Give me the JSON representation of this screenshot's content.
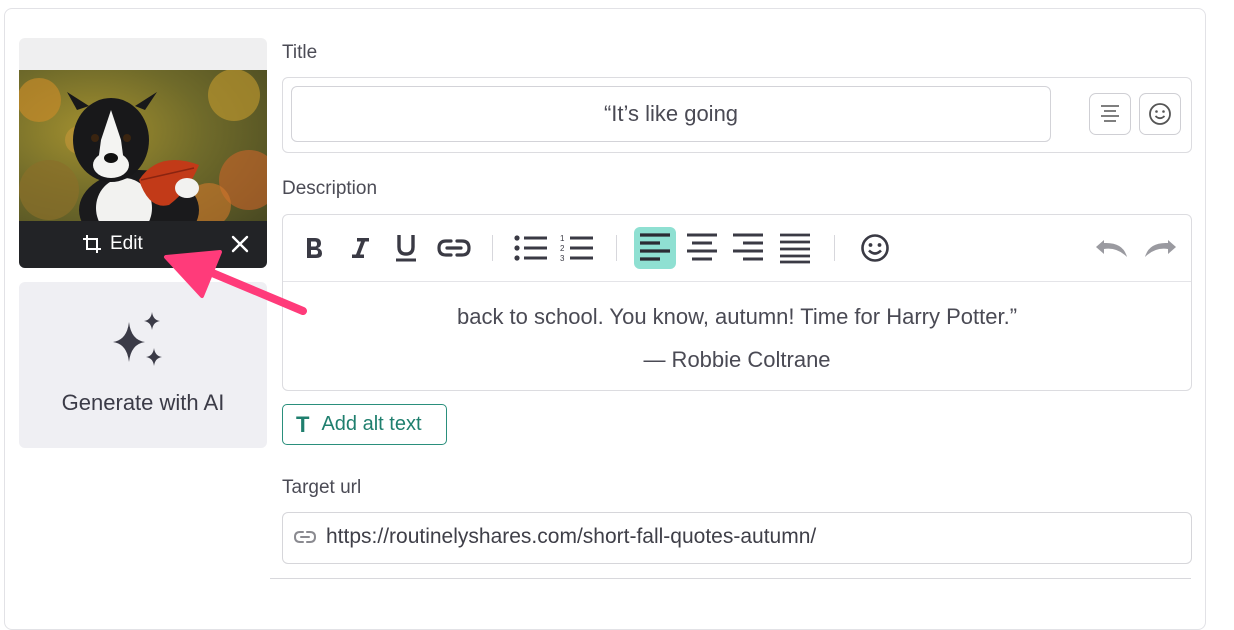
{
  "image_card": {
    "edit_label": "Edit",
    "edit_icon": "crop-icon",
    "close_icon": "close-icon"
  },
  "ai_card": {
    "label": "Generate with AI",
    "icon": "sparkles-icon"
  },
  "title_field": {
    "label": "Title",
    "value": "“It’s like going"
  },
  "description": {
    "label": "Description",
    "toolbar": [
      "bold-icon",
      "italic-icon",
      "underline-icon",
      "link-icon",
      "bullet-list-icon",
      "numbered-list-icon",
      "align-left-icon",
      "align-center-icon",
      "align-right-icon",
      "align-justify-icon",
      "emoji-icon",
      "undo-icon",
      "redo-icon"
    ],
    "active_tool": "align-left-icon",
    "line1": "back to school. You know, autumn! Time for Harry Potter.”",
    "line2": "— Robbie Coltrane"
  },
  "alt_text": {
    "icon_glyph": "T",
    "label": "Add alt text"
  },
  "target_url": {
    "label": "Target url",
    "value": "https://routinelyshares.com/short-fall-quotes-autumn/"
  },
  "colors": {
    "accent": "#1f7f6e",
    "active_tool_bg": "#8fe0d2",
    "annotation_arrow": "#ff3b7a",
    "edit_bar": "#222326"
  }
}
